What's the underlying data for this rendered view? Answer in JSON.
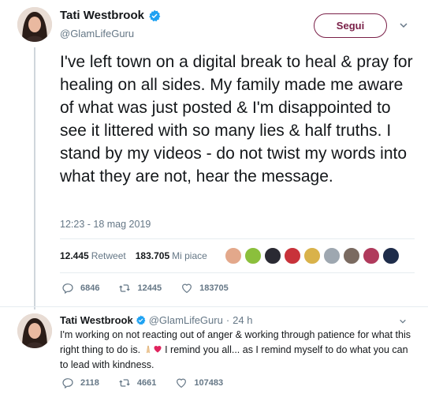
{
  "tweet": {
    "author_name": "Tati Westbrook",
    "author_handle": "@GlamLifeGuru",
    "follow_label": "Segui",
    "text": "I've left town on a digital break to heal & pray for healing on all sides. My family made me aware of what was just posted & I'm disappointed to see it littered with so many lies & half truths. I stand by my videos - do not twist my words into what they are not, hear the message.",
    "timestamp": "12:23 - 18 mag 2019",
    "retweet_count": "12.445",
    "retweet_label": "Retweet",
    "like_count": "183.705",
    "like_label": "Mi piace",
    "reply_action_count": "6846",
    "retweet_action_count": "12445",
    "like_action_count": "183705"
  },
  "reply": {
    "author_name": "Tati Westbrook",
    "author_handle": "@GlamLifeGuru",
    "separator": "·",
    "time": "24 h",
    "text_before_emoji": "I'm working on not reacting out of anger & working through patience for what this right thing to do is. ",
    "text_after_emoji": " I remind you all... as I remind myself to do what you can to lead with kindness.",
    "reply_count": "2118",
    "retweet_count": "4661",
    "like_count": "107483"
  },
  "colors": {
    "follow_accent": "#7a2048",
    "verified_blue": "#1da1f2",
    "muted_text": "#657786"
  }
}
